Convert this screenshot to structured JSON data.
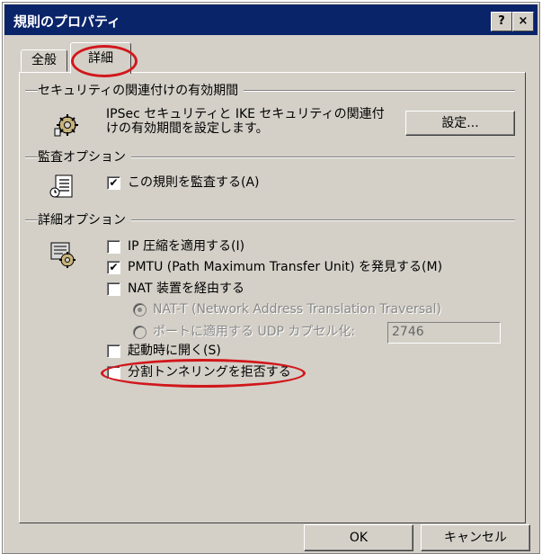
{
  "window": {
    "title": "規則のプロパティ",
    "help_label": "?",
    "close_label": "×"
  },
  "tabs": [
    {
      "label": "全般",
      "selected": false
    },
    {
      "label": "詳細",
      "selected": true
    }
  ],
  "sections": {
    "ike": {
      "title": "セキュリティの関連付けの有効期間",
      "description_line1": "IPSec セキュリティと IKE セキュリティの関連付",
      "description_line2": "けの有効期間を設定します。",
      "settings_button": "設定..."
    },
    "audit": {
      "title": "監査オプション",
      "audit_checkbox": {
        "label": "この規則を監査する(A)",
        "checked": true
      }
    },
    "advanced": {
      "title": "詳細オプション",
      "ip_compression": {
        "label": "IP 圧縮を適用する(I)",
        "checked": false
      },
      "pmtu": {
        "label": "PMTU (Path Maximum Transfer Unit) を発見する(M)",
        "checked": true
      },
      "nat": {
        "label": "NAT 装置を経由する",
        "checked": false
      },
      "nat_t_radio": {
        "label": "NAT-T (Network Address Translation Traversal)",
        "selected": true,
        "enabled": false
      },
      "udp_radio": {
        "label": "ポートに適用する UDP カプセル化:",
        "selected": false,
        "enabled": false
      },
      "udp_port": "2746",
      "startup": {
        "label": "起動時に開く(S)",
        "checked": false
      },
      "split_tunnel": {
        "label": "分割トンネリングを拒否する",
        "checked": false
      }
    }
  },
  "footer": {
    "ok_label": "OK",
    "cancel_label": "キャンセル"
  },
  "annotation_color": "#d1171b"
}
